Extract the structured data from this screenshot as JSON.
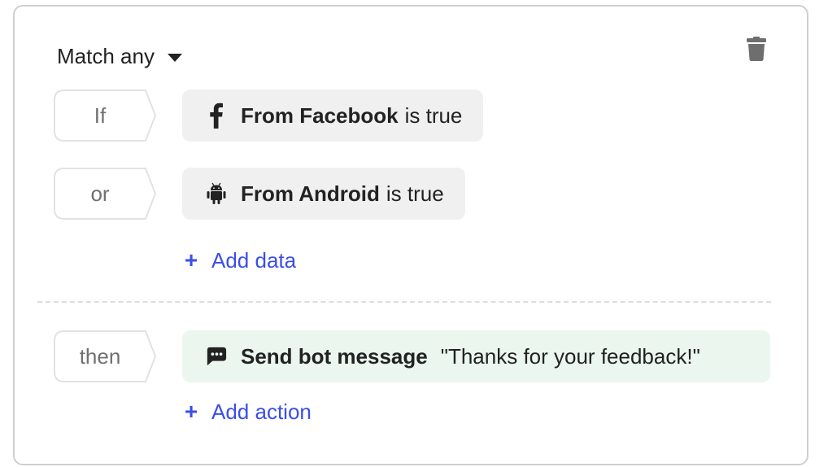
{
  "rule": {
    "match_selector": {
      "label": "Match any",
      "icon": "caret-down-icon"
    },
    "delete_icon": "trash-icon",
    "conditions": [
      {
        "connector": "If",
        "icon": "facebook-icon",
        "field": "From Facebook",
        "operator": "is true"
      },
      {
        "connector": "or",
        "icon": "android-icon",
        "field": "From Android",
        "operator": "is true"
      }
    ],
    "add_data": {
      "icon": "plus-icon",
      "label": "Add data"
    },
    "actions": [
      {
        "connector": "then",
        "icon": "chat-bubble-icon",
        "action": "Send bot message",
        "value": "\"Thanks for your feedback!\""
      }
    ],
    "add_action": {
      "icon": "plus-icon",
      "label": "Add action"
    }
  },
  "colors": {
    "link": "#3a4ee8",
    "chip_condition_bg": "#f0f0f0",
    "chip_action_bg": "#eaf6ee",
    "border": "#cfcfcf"
  }
}
